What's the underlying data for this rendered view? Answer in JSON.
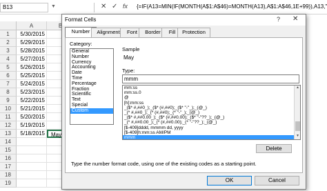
{
  "formula_bar": {
    "name_box": "B13",
    "cancel_symbol": "✕",
    "enter_symbol": "✓",
    "fx_label": "fx",
    "formula": "{=IF(A13=MIN(IF(MONTH(A$1:A$46)=MONTH(A13),A$1:A$46,1E+99)),A13,\"\")}"
  },
  "sheet": {
    "columns": [
      "A",
      "B"
    ],
    "rows": [
      {
        "num": "1",
        "a": "5/30/2015",
        "b": ""
      },
      {
        "num": "2",
        "a": "5/29/2015",
        "b": ""
      },
      {
        "num": "3",
        "a": "5/28/2015",
        "b": ""
      },
      {
        "num": "4",
        "a": "5/27/2015",
        "b": ""
      },
      {
        "num": "5",
        "a": "5/26/2015",
        "b": ""
      },
      {
        "num": "6",
        "a": "5/25/2015",
        "b": ""
      },
      {
        "num": "7",
        "a": "5/24/2015",
        "b": ""
      },
      {
        "num": "8",
        "a": "5/23/2015",
        "b": ""
      },
      {
        "num": "9",
        "a": "5/22/2015",
        "b": ""
      },
      {
        "num": "10",
        "a": "5/21/2015",
        "b": ""
      },
      {
        "num": "11",
        "a": "5/20/2015",
        "b": ""
      },
      {
        "num": "12",
        "a": "5/19/2015",
        "b": ""
      },
      {
        "num": "13",
        "a": "5/18/2015",
        "b": "May"
      },
      {
        "num": "14",
        "a": "",
        "b": ""
      },
      {
        "num": "15",
        "a": "",
        "b": ""
      },
      {
        "num": "16",
        "a": "",
        "b": ""
      },
      {
        "num": "17",
        "a": "",
        "b": ""
      },
      {
        "num": "18",
        "a": "",
        "b": ""
      },
      {
        "num": "19",
        "a": "",
        "b": ""
      }
    ]
  },
  "dialog": {
    "title": "Format Cells",
    "help": "?",
    "close": "✕",
    "tabs": [
      "Number",
      "Alignment",
      "Font",
      "Border",
      "Fill",
      "Protection"
    ],
    "active_tab": "Number",
    "category_label": "Category:",
    "categories": [
      "General",
      "Number",
      "Currency",
      "Accounting",
      "Date",
      "Time",
      "Percentage",
      "Fraction",
      "Scientific",
      "Text",
      "Special",
      "Custom"
    ],
    "selected_category": "Custom",
    "sample_label": "Sample",
    "sample_value": "May",
    "type_label": "Type:",
    "type_value": "mmm",
    "formats": [
      "mm:ss",
      "mm:ss.0",
      "@",
      "[h]:mm:ss",
      "_($* #,##0_);_($* (#,##0);_($* \"-\"_);_(@_)",
      "_(* #,##0_);_(* (#,##0);_(* \"-\"_);_(@_)",
      "_($* #,##0.00_);_($* (#,##0.00);_($* \"-\"??_);_(@_)",
      "_(* #,##0.00_);_(* (#,##0.00);_(* \"-\"??_);_(@_)",
      "[$-409]dddd, mmmm dd, yyyy",
      "[$-409]h:mm:ss AM/PM",
      "mmm"
    ],
    "selected_format": "mmm",
    "delete_label": "Delete",
    "hint": "Type the number format code, using one of the existing codes as a starting point.",
    "ok_label": "OK",
    "cancel_label": "Cancel",
    "scroll_up": "▲",
    "scroll_down": "▼"
  }
}
